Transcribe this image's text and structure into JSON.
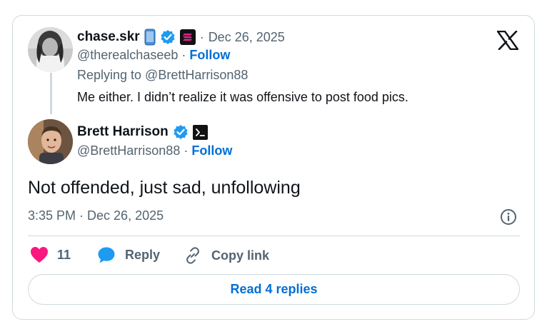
{
  "quoted": {
    "name": "chase.skr",
    "handle": "@therealchaseeb",
    "sep": "·",
    "follow": "Follow",
    "date": "Dec 26, 2025",
    "replying_to": "Replying to @BrettHarrison88",
    "text": "Me either. I didn’t realize it was offensive to post food pics."
  },
  "author": {
    "name": "Brett Harrison",
    "handle": "@BrettHarrison88",
    "sep": "·",
    "follow": "Follow"
  },
  "post": {
    "text": "Not offended, just sad, unfollowing",
    "timestamp": "3:35 PM · Dec 26, 2025"
  },
  "actions": {
    "like_count": "11",
    "reply_label": "Reply",
    "copy_label": "Copy link",
    "read_replies": "Read 4 replies"
  },
  "colors": {
    "verified_blue": "#1d9bf0",
    "like_pink": "#f91880",
    "link_blue": "#006fd6",
    "reply_bubble": "#1d9bf0"
  },
  "icons": [
    "x-logo-icon",
    "verified-badge-icon",
    "phone-icon",
    "solana-icon",
    "terminal-icon",
    "heart-icon",
    "reply-bubble-icon",
    "link-icon",
    "info-icon"
  ]
}
